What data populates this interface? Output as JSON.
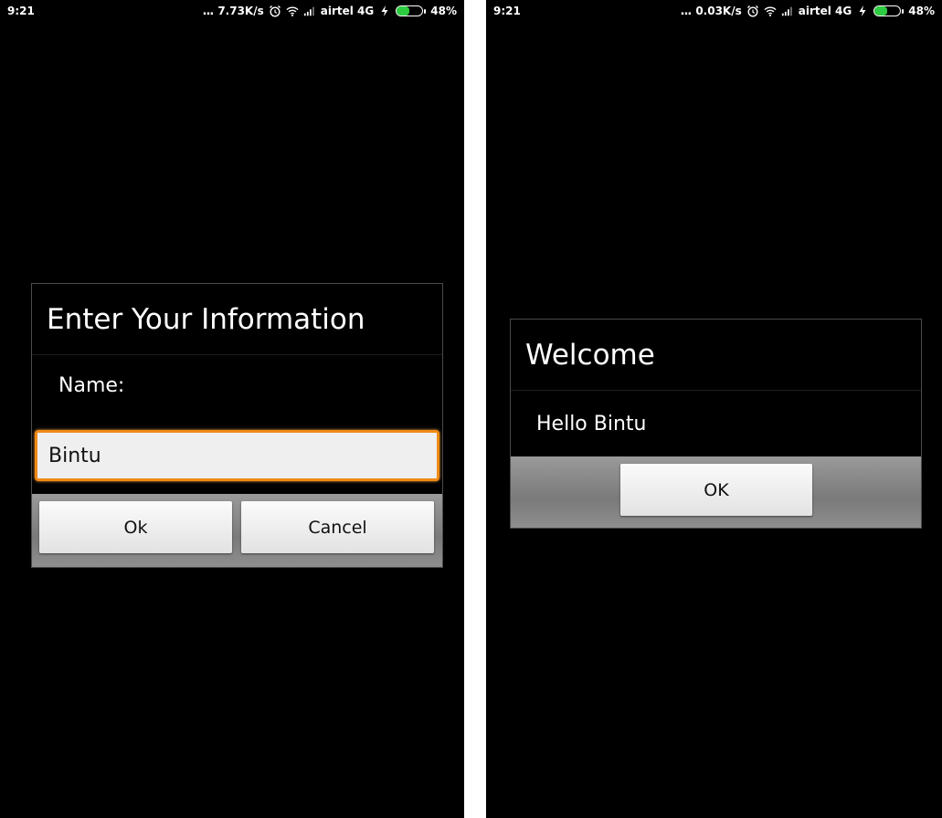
{
  "left_screen": {
    "status_bar": {
      "time": "9:21",
      "dots": "...",
      "net_speed": "7.73K/s",
      "carrier": "airtel 4G",
      "battery": "48%",
      "battery_level": 0.48
    },
    "dialog": {
      "title": "Enter Your Information",
      "label": "Name:",
      "input_value": "Bintu",
      "ok_label": "Ok",
      "cancel_label": "Cancel"
    }
  },
  "right_screen": {
    "status_bar": {
      "time": "9:21",
      "dots": "...",
      "net_speed": "0.03K/s",
      "carrier": "airtel 4G",
      "battery": "48%",
      "battery_level": 0.48
    },
    "dialog": {
      "title": "Welcome",
      "message": "Hello Bintu",
      "ok_label": "OK"
    }
  },
  "colors": {
    "input_focus_border": "#f08a15",
    "battery_fill": "#2ecc40",
    "background": "#000000"
  },
  "icons": [
    "alarm-icon",
    "wifi-icon",
    "signal-icon",
    "charging-icon",
    "battery-icon"
  ]
}
